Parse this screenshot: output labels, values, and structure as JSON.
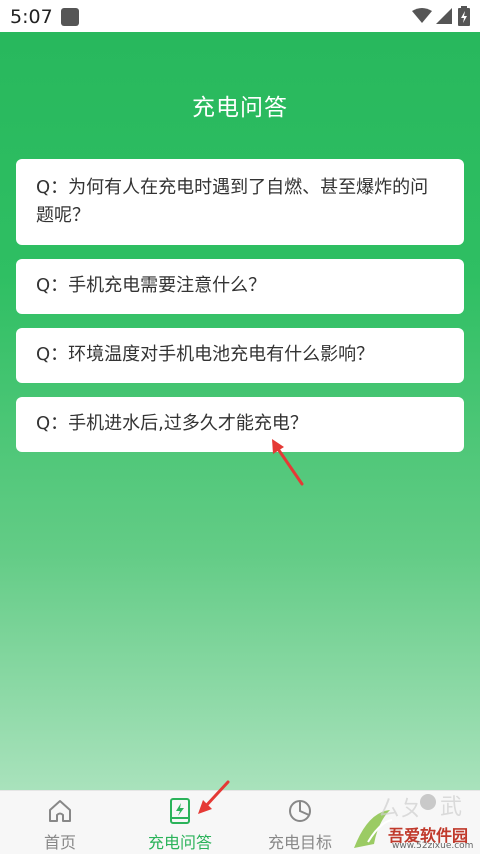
{
  "status_bar": {
    "time": "5:07"
  },
  "page": {
    "title": "充电问答"
  },
  "faq": [
    {
      "text": "Q：为何有人在充电时遇到了自燃、甚至爆炸的问题呢？"
    },
    {
      "text": "Q：手机充电需要注意什么？"
    },
    {
      "text": "Q：环境温度对手机电池充电有什么影响？"
    },
    {
      "text": "Q：手机进水后,过多久才能充电？"
    }
  ],
  "nav": [
    {
      "label": "首页",
      "icon": "home-icon"
    },
    {
      "label": "充电问答",
      "icon": "charging-phone-icon",
      "active": true
    },
    {
      "label": "充电目标",
      "icon": "pie-chart-icon"
    }
  ],
  "watermark": {
    "text": "吾爱软件园",
    "url": "www.52zixue.com"
  },
  "colors": {
    "accent": "#2bb35a",
    "arrow": "#e53935"
  }
}
